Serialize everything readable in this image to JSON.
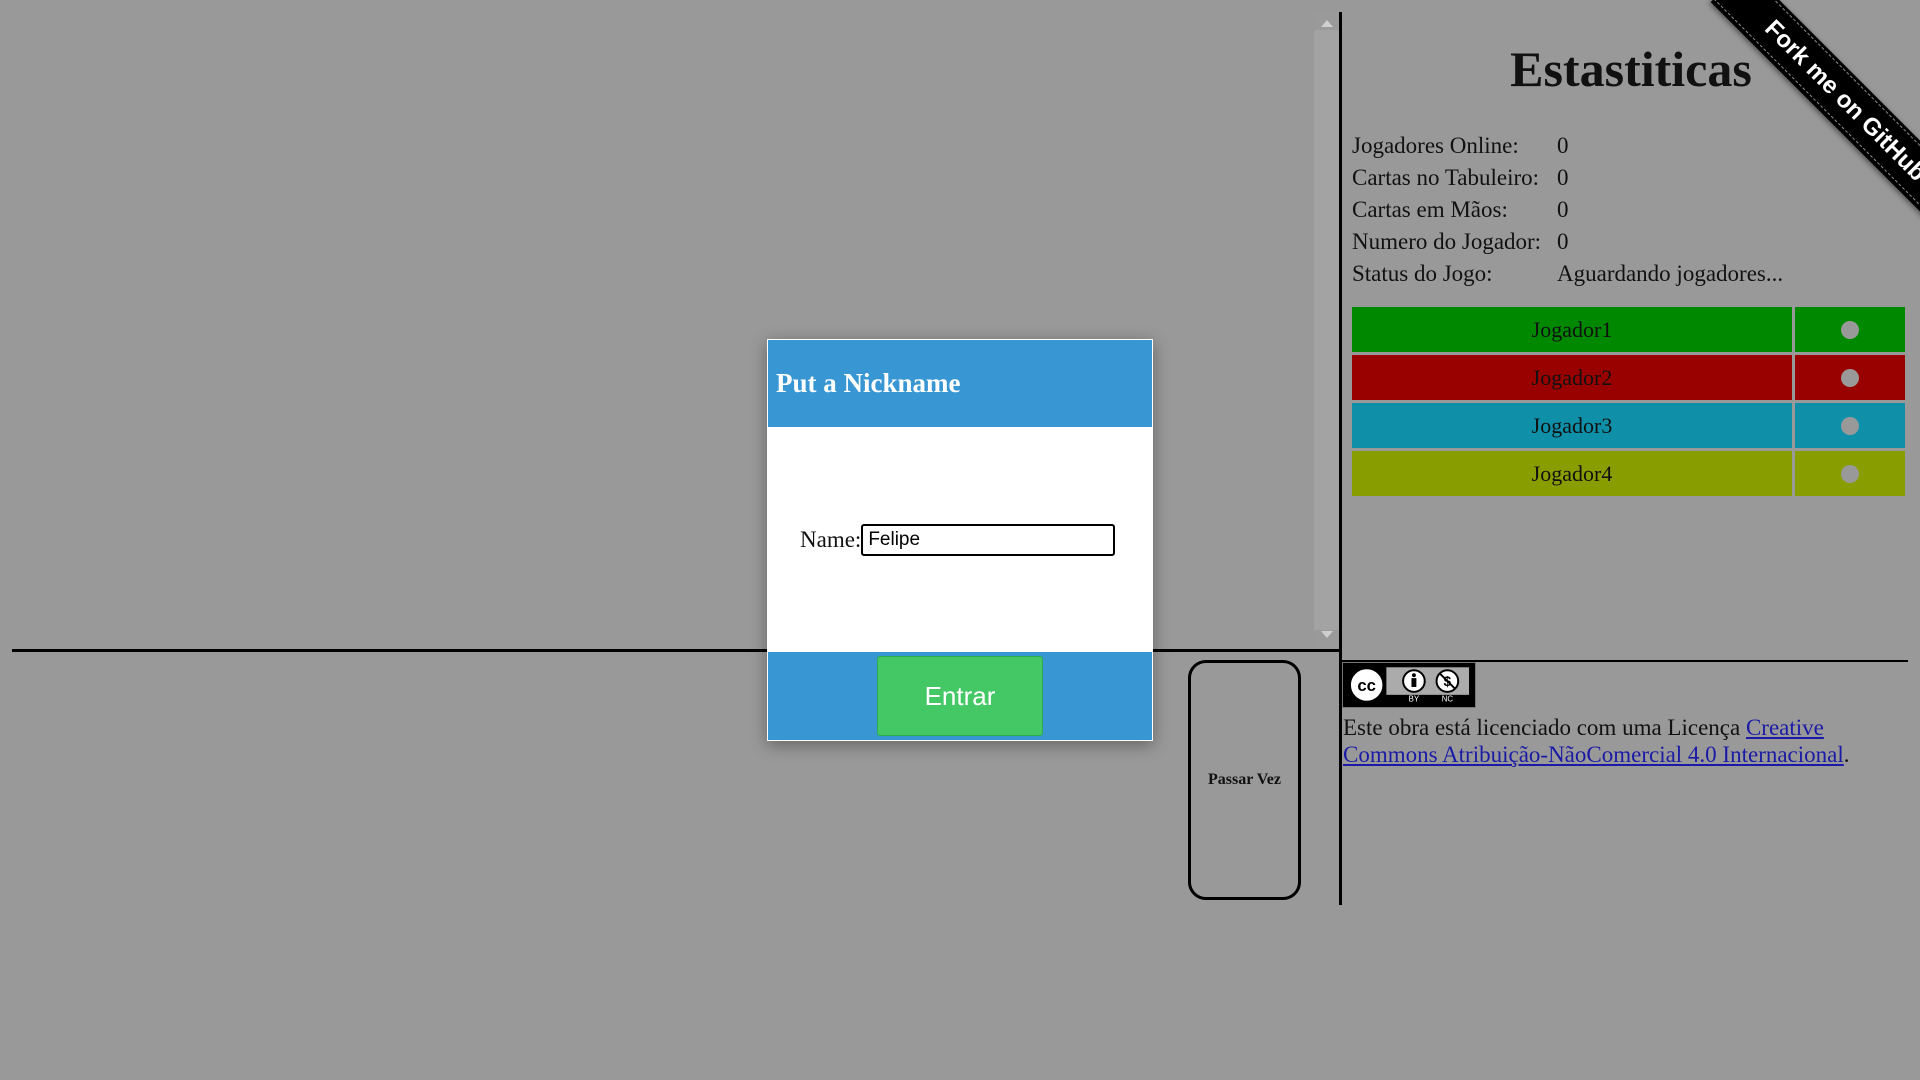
{
  "stats": {
    "title": "Estastiticas",
    "rows": [
      {
        "label": "Jogadores Online:",
        "value": "0"
      },
      {
        "label": "Cartas no Tabuleiro:",
        "value": "0"
      },
      {
        "label": "Cartas em Mãos:",
        "value": "0"
      },
      {
        "label": "Numero do Jogador:",
        "value": "0"
      },
      {
        "label": "Status do Jogo:",
        "value": "Aguardando jogadores..."
      }
    ]
  },
  "players": [
    {
      "name": "Jogador1",
      "color": "#008800"
    },
    {
      "name": "Jogador2",
      "color": "#990000"
    },
    {
      "name": "Jogador3",
      "color": "#0f8fa8"
    },
    {
      "name": "Jogador4",
      "color": "#889e00"
    }
  ],
  "pass_button": {
    "label": "Passar Vez"
  },
  "license": {
    "badge_labels": [
      "BY",
      "NC"
    ],
    "text_before": "Este obra está licenciado com uma Licença ",
    "link_text": "Creative Commons Atribuição-NãoComercial 4.0 Internacional",
    "text_after": "."
  },
  "ribbon": {
    "label": "Fork me on GitHub"
  },
  "modal": {
    "title": "Put a Nickname",
    "name_label": "Name:",
    "name_value": "Felipe",
    "enter_label": "Entrar"
  },
  "colors": {
    "background": "#999999",
    "modal_header": "#3896d3",
    "enter_button": "#44c765"
  }
}
